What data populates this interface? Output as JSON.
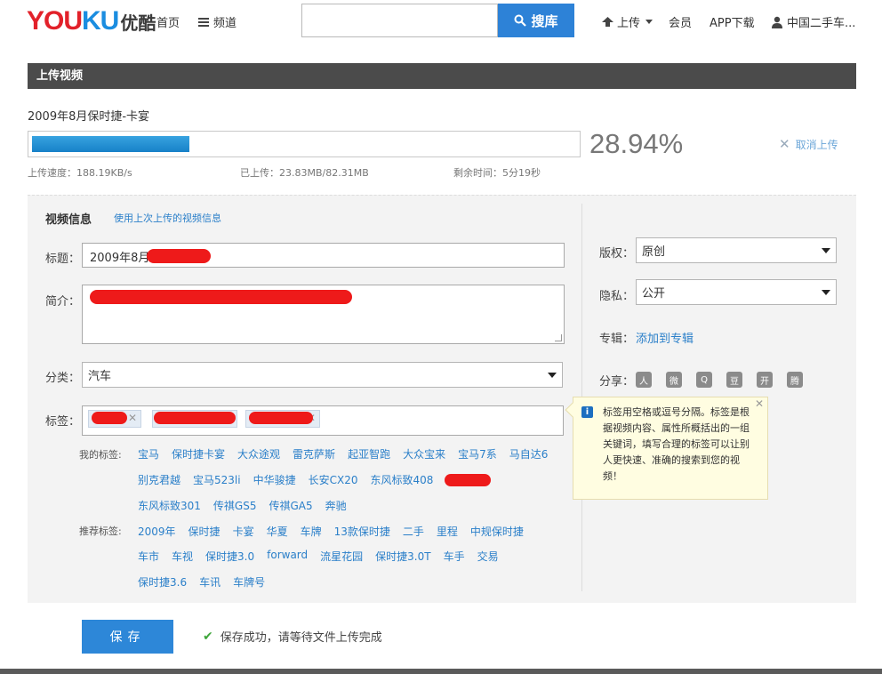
{
  "nav": {
    "logo_part1": "YOU",
    "logo_part2": "KU",
    "logo_cn": "优酷",
    "home": "首页",
    "channel": "频道",
    "search_placeholder": "",
    "search_button": "搜库",
    "upload": "上传",
    "member": "会员",
    "app": "APP下载",
    "user": "中国二手车..."
  },
  "section_title": "上传视频",
  "upload": {
    "filename": "2009年8月保时捷-卡宴",
    "progress": 0.2894,
    "percent_text": "28.94%",
    "cancel": "取消上传",
    "speed": "上传速度：188.19KB/s",
    "uploaded": "已上传：23.83MB/82.31MB",
    "remaining": "剩余时间：5分19秒"
  },
  "form": {
    "info_title": "视频信息",
    "use_last": "使用上次上传的视频信息",
    "title_label": "标题：",
    "title_value": "2009年8月",
    "desc_label": "简介：",
    "category_label": "分类：",
    "category_value": "汽车",
    "tags_label": "标签：",
    "my_tags_label": "我的标签:",
    "my_tags_row1": [
      "宝马",
      "保时捷卡宴",
      "大众途观",
      "雷克萨斯",
      "起亚智跑",
      "大众宝来",
      "宝马7系",
      "马自达6"
    ],
    "my_tags_row2": [
      "别克君越",
      "宝马523li",
      "中华骏捷",
      "长安CX20",
      "东风标致408",
      "中"
    ],
    "my_tags_row3": [
      "东风标致301",
      "传祺GS5",
      "传祺GA5",
      "奔驰"
    ],
    "rec_tags_label": "推荐标签:",
    "rec_tags_row1": [
      "2009年",
      "保时捷",
      "卡宴",
      "华夏",
      "车牌",
      "13款保时捷",
      "二手",
      "里程",
      "中规保时捷"
    ],
    "rec_tags_row2": [
      "车市",
      "车视",
      "保时捷3.0",
      "forward",
      "流星花园",
      "保时捷3.0T",
      "车手",
      "交易"
    ],
    "rec_tags_row3": [
      "保时捷3.6",
      "车讯",
      "车牌号"
    ],
    "copyright_label": "版权：",
    "copyright_value": "原创",
    "privacy_label": "隐私：",
    "privacy_value": "公开",
    "album_label": "专辑：",
    "album_link": "添加到专辑",
    "share_label": "分享：",
    "tooltip": "标签用空格或逗号分隔。标签是根据视频内容、属性所概括出的一组关键词，填写合理的标签可以让别人更快速、准确的搜索到您的视频！",
    "save_button": "保存",
    "save_msg": "保存成功，请等待文件上传完成"
  },
  "colors": {
    "accent": "#2d82d7",
    "link": "#2a7fc9",
    "progress": "#1781c8",
    "header_bar": "#4b4b4b"
  }
}
